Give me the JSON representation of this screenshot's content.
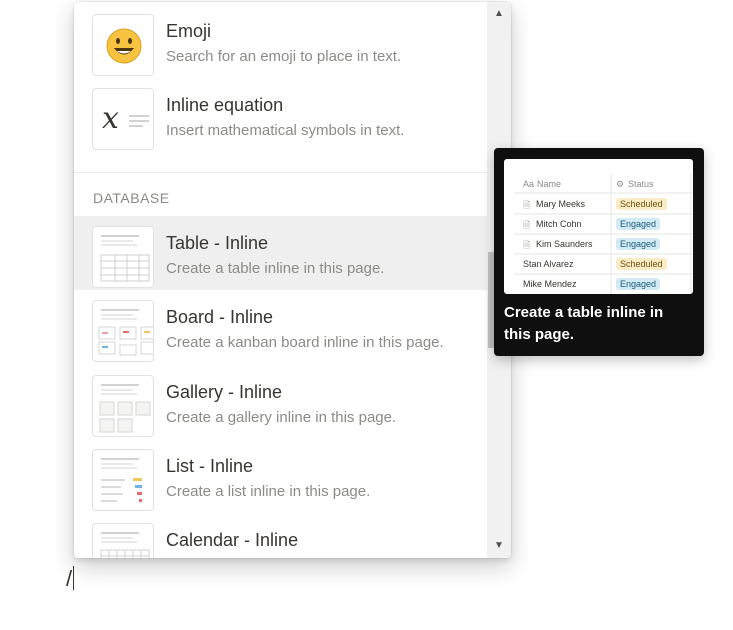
{
  "menu": {
    "items_top": [
      {
        "title": "Emoji",
        "desc": "Search for an emoji to place in text."
      },
      {
        "title": "Inline equation",
        "desc": "Insert mathematical symbols in text."
      }
    ],
    "section_label": "DATABASE",
    "items_db": [
      {
        "title": "Table - Inline",
        "desc": "Create a table inline in this page."
      },
      {
        "title": "Board - Inline",
        "desc": "Create a kanban board inline in this page."
      },
      {
        "title": "Gallery - Inline",
        "desc": "Create a gallery inline in this page."
      },
      {
        "title": "List - Inline",
        "desc": "Create a list inline in this page."
      },
      {
        "title": "Calendar - Inline",
        "desc": ""
      }
    ],
    "equation_glyph": "x"
  },
  "tooltip": {
    "text": "Create a table inline in this page.",
    "preview": {
      "col_name": "Name",
      "col_status": "Status",
      "rows": [
        {
          "name": "Mary Meeks",
          "status": "Scheduled"
        },
        {
          "name": "Mitch Cohn",
          "status": "Engaged"
        },
        {
          "name": "Kim Saunders",
          "status": "Engaged"
        },
        {
          "name": "Stan Alvarez",
          "status": "Scheduled"
        },
        {
          "name": "Mike Mendez",
          "status": "Engaged"
        }
      ]
    }
  },
  "editor": {
    "typed": "/"
  },
  "colors": {
    "scheduled_bg": "#fbecc5",
    "engaged_bg": "#d3ebf5",
    "selected_bg": "#efefef"
  }
}
